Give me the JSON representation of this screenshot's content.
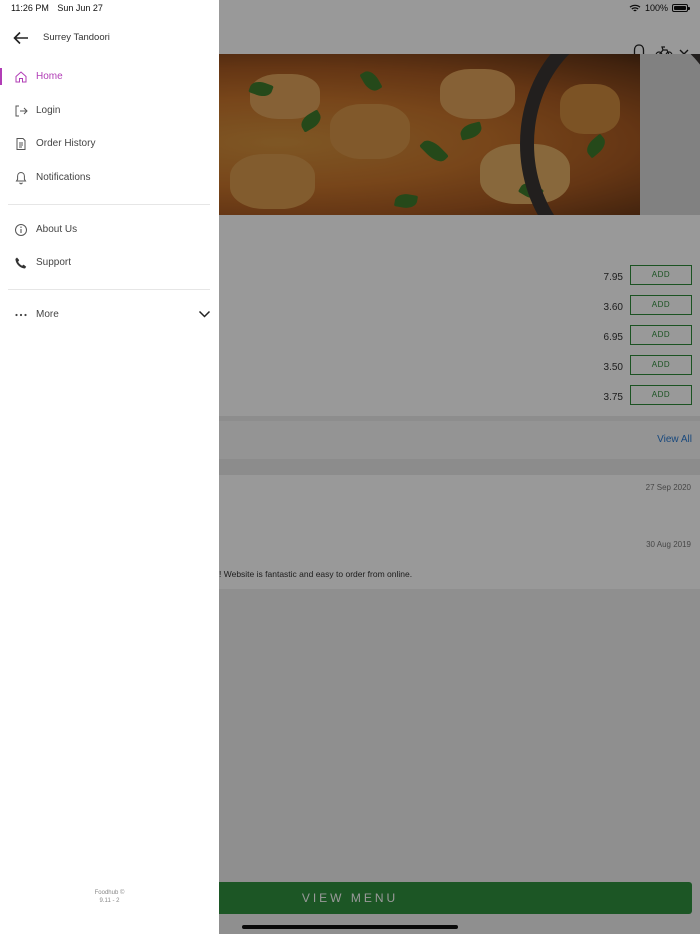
{
  "status_bar": {
    "time": "11:26 PM",
    "date": "Sun Jun 27",
    "battery": "100%"
  },
  "drawer": {
    "restaurant_name": "Surrey Tandoori",
    "nav_items": [
      {
        "label": "Home",
        "icon": "home-icon",
        "active": true
      },
      {
        "label": "Login",
        "icon": "login-icon",
        "active": false
      },
      {
        "label": "Order History",
        "icon": "receipt-icon",
        "active": false
      },
      {
        "label": "Notifications",
        "icon": "bell-icon",
        "active": false
      }
    ],
    "secondary_items": [
      {
        "label": "About Us",
        "icon": "info-icon"
      },
      {
        "label": "Support",
        "icon": "phone-icon"
      }
    ],
    "more_label": "More",
    "footer_line1": "Foodhub ©",
    "footer_line2": "9.11 - 2"
  },
  "background": {
    "menu_items": [
      {
        "price": "7.95",
        "button": "ADD"
      },
      {
        "price": "3.60",
        "button": "ADD"
      },
      {
        "price": "6.95",
        "button": "ADD"
      },
      {
        "price": "3.50",
        "button": "ADD"
      },
      {
        "price": "3.75",
        "button": "ADD"
      }
    ],
    "view_all": "View All",
    "reviews": [
      {
        "date": "27 Sep 2020",
        "text": ""
      },
      {
        "date": "30 Aug 2019",
        "text": "! Website is fantastic and easy to order from online."
      }
    ],
    "view_menu_label": "VIEW MENU"
  },
  "colors": {
    "accent": "#b13db6",
    "green": "#2e8b3a",
    "link": "#2a7ad1"
  }
}
